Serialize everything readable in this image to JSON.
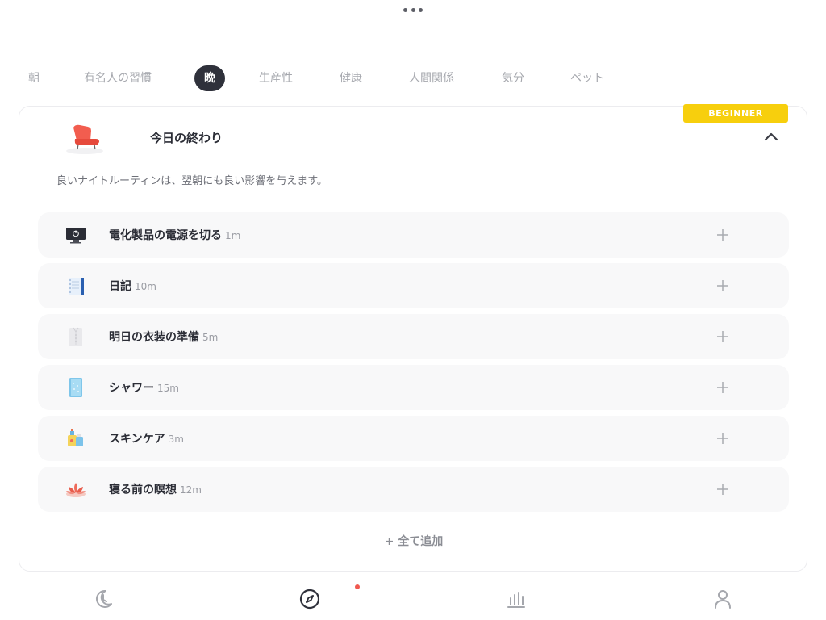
{
  "header": {
    "more_icon": "more-horizontal-icon"
  },
  "tabs": [
    {
      "label": "朝",
      "active": false
    },
    {
      "label": "有名人の習慣",
      "active": false
    },
    {
      "label": "晩",
      "active": true
    },
    {
      "label": "生産性",
      "active": false
    },
    {
      "label": "健康",
      "active": false
    },
    {
      "label": "人間関係",
      "active": false
    },
    {
      "label": "気分",
      "active": false
    },
    {
      "label": "ペット",
      "active": false
    }
  ],
  "card": {
    "badge": "BEGINNER",
    "title": "今日の終わり",
    "description": "良いナイトルーティンは、翌朝にも良い影響を与えます。",
    "hero_icon": "armchair-icon",
    "collapse_icon": "chevron-up-icon",
    "add_all_label": "+ 全て追加"
  },
  "routines": [
    {
      "name": "電化製品の電源を切る",
      "duration": "1m",
      "icon": "monitor-power-icon"
    },
    {
      "name": "日記",
      "duration": "10m",
      "icon": "notebook-icon"
    },
    {
      "name": "明日の衣装の準備",
      "duration": "5m",
      "icon": "shirt-icon"
    },
    {
      "name": "シャワー",
      "duration": "15m",
      "icon": "shower-icon"
    },
    {
      "name": "スキンケア",
      "duration": "3m",
      "icon": "skincare-icon"
    },
    {
      "name": "寝る前の瞑想",
      "duration": "12m",
      "icon": "lotus-icon"
    }
  ],
  "bottom_nav": [
    {
      "icon": "moon-icon"
    },
    {
      "icon": "compass-icon",
      "has_notification": true
    },
    {
      "icon": "bar-chart-icon"
    },
    {
      "icon": "person-icon"
    }
  ],
  "colors": {
    "accent_dark": "#2f313b",
    "badge": "#f7cf0d",
    "notification": "#f0584f"
  }
}
